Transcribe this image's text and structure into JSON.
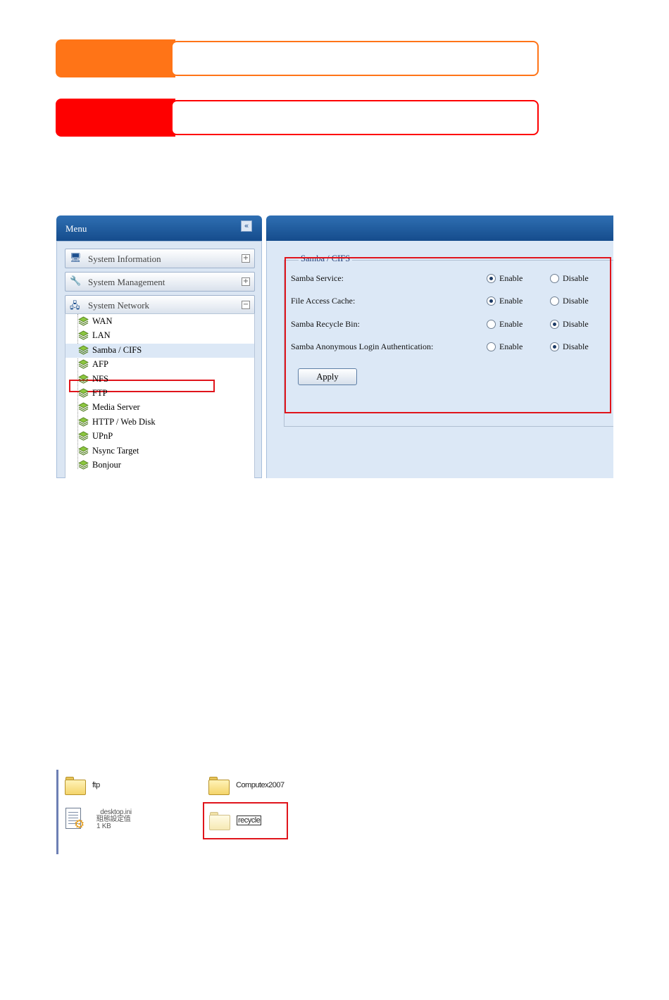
{
  "callouts": [
    {
      "type": "note",
      "color": "#ff7417"
    },
    {
      "type": "warning",
      "color": "#fe0000"
    }
  ],
  "menu": {
    "title": "Menu",
    "collapse_glyph": "«",
    "sections": [
      {
        "label": "System Information",
        "toggle": "+",
        "icon": "computer-icon"
      },
      {
        "label": "System Management",
        "toggle": "+",
        "icon": "tools-icon"
      },
      {
        "label": "System Network",
        "toggle": "−",
        "icon": "network-icon"
      }
    ],
    "network_items": [
      "WAN",
      "LAN",
      "Samba / CIFS",
      "AFP",
      "NFS",
      "FTP",
      "Media Server",
      "HTTP / Web Disk",
      "UPnP",
      "Nsync Target",
      "Bonjour"
    ],
    "selected_item": "Samba / CIFS"
  },
  "samba": {
    "legend": "Samba / CIFS",
    "rows": [
      {
        "label": "Samba Service:",
        "enable": "Enable",
        "disable": "Disable",
        "value": "Enable"
      },
      {
        "label": "File Access Cache:",
        "enable": "Enable",
        "disable": "Disable",
        "value": "Enable"
      },
      {
        "label": "Samba Recycle Bin:",
        "enable": "Enable",
        "disable": "Disable",
        "value": "Disable"
      },
      {
        "label": "Samba Anonymous Login Authentication:",
        "enable": "Enable",
        "disable": "Disable",
        "value": "Disable"
      }
    ],
    "apply_label": "Apply"
  },
  "explorer": {
    "items": [
      {
        "name": "ftp",
        "icon": "folder-icon"
      },
      {
        "name": "Computex2007",
        "icon": "folder-icon"
      },
      {
        "name": "_desktop.ini",
        "line2": "組態設定值",
        "line3": "1 KB",
        "icon": "ini-file-icon"
      },
      {
        "name": "recycle",
        "icon": "folder-icon"
      }
    ]
  },
  "colors": {
    "accent_blue": "#154c8c",
    "highlight_red": "#e0141b"
  }
}
